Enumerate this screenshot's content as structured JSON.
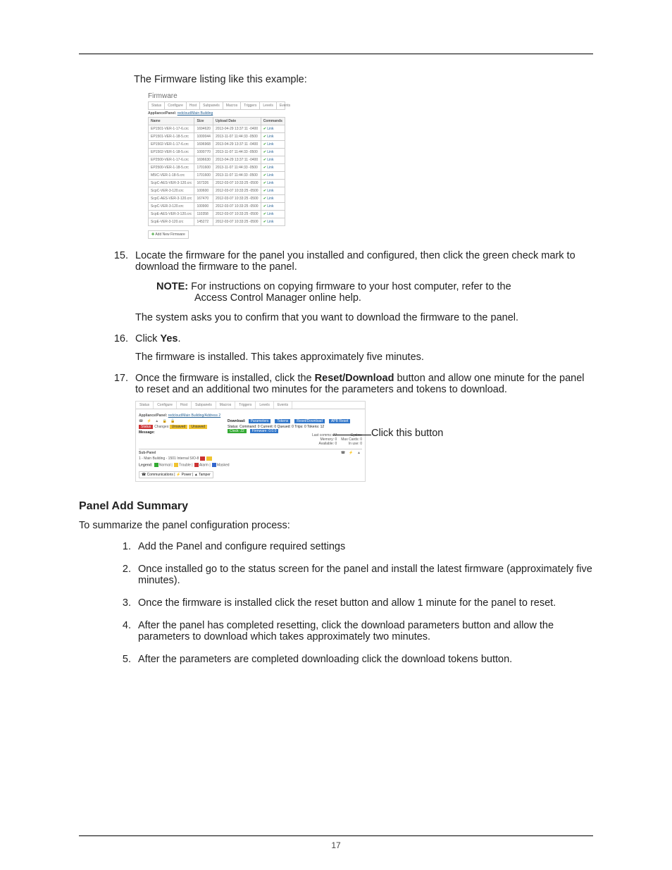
{
  "intro": "The Firmware listing like this example:",
  "firmware": {
    "title": "Firmware",
    "tabs": [
      "Status",
      "Configure",
      "Host",
      "Subpanels",
      "Macros",
      "Triggers",
      "Levels",
      "Events"
    ],
    "appLabel": "Appliance/Panel:",
    "appValue": "redcloud/Main Building",
    "headers": [
      "Name",
      "Size",
      "Upload Date",
      "Commands"
    ],
    "rows": [
      [
        "EP1501-VER-1-17-6.crc",
        "1694620",
        "2013-04-29 13:37:11 -0400"
      ],
      [
        "EP1501-VER-1-18-5.crc",
        "1000044",
        "2013-11-07 11:44:33 -0500"
      ],
      [
        "EP1502-VER-1-17-6.crc",
        "1696968",
        "2013-04-29 13:37:11 -0400"
      ],
      [
        "EP1502-VER-1-18-5.crc",
        "1000770",
        "2013-11-07 11:44:33 -0500"
      ],
      [
        "EP2500-VER-1-17-6.crc",
        "1696630",
        "2013-04-29 13:37:11 -0400"
      ],
      [
        "EP2500-VER-1-18-5.crc",
        "1701600",
        "2013-11-07 11:44:33 -0500"
      ],
      [
        "M5IC-VER-1-18-5.crc",
        "1701600",
        "2013-11-07 11:44:33 -0500"
      ],
      [
        "ScpC-AES-VER-3-120.crc",
        "167326",
        "2012-03-07 10:33:25 -0500"
      ],
      [
        "ScpC-VER-3-120.crc",
        "100600",
        "2012-03-07 10:33:25 -0500"
      ],
      [
        "ScpC-AES-VER-3-120.crc",
        "167470",
        "2012-03-07 10:33:25 -0500"
      ],
      [
        "ScpC-VER-3-120.crc",
        "100900",
        "2012-03-07 10:33:25 -0500"
      ],
      [
        "ScpE-AES-VER-3-120.crc",
        "110358",
        "2012-03-07 10:33:25 -0500"
      ],
      [
        "ScpE-VER-3-120.crc",
        "145272",
        "2012-03-07 10:33:25 -0500"
      ]
    ],
    "cmdLink": "Link",
    "addNew": "Add New Firmware"
  },
  "step15": {
    "text": "Locate the firmware for the panel you installed and configured, then click the green check mark to download the firmware to the panel.",
    "noteLabel": "NOTE:",
    "noteLine1": "For instructions on copying firmware to your host computer, refer to the",
    "noteLine2": "Access Control Manager online help.",
    "after": "The system asks you to confirm that you want to download the firmware to the panel."
  },
  "step16": {
    "pre": "Click ",
    "bold": "Yes",
    "post": ".",
    "after": "The firmware is installed. This takes approximately five minutes."
  },
  "step17": {
    "pre": "Once the firmware is installed, click the ",
    "bold": "Reset/Download",
    "post": " button and allow one minute for the panel to reset and an additional two minutes for the parameters and tokens to download."
  },
  "status": {
    "tabs": [
      "Status",
      "Configure",
      "Host",
      "Subpanels",
      "Macros",
      "Triggers",
      "Levels",
      "Events"
    ],
    "appLabel": "Appliance/Panel:",
    "appValue": "redcloud/Main Building/Address 2",
    "msgLabel": "Message:",
    "statusWord": "Status",
    "changesLabel": "Changes:",
    "unsaved1": "Unsaved",
    "unsaved2": "Unsaved",
    "dlLabel": "Download:",
    "btnParams": "Parameters",
    "btnTokens": "Tokens",
    "btnReset": "Reset/Download",
    "btnApb": "APB Reset",
    "line_status": "Status: Command: 0   Current: 0  Queued: 0   Trips: 0  Tokens: 12",
    "clock": "Clock: 22",
    "fw": "Firmware: 0.0.0",
    "leftCol": [
      "Last comms: 77",
      "Memory: 0",
      "Available: 0"
    ],
    "rightCol": [
      "Cycles:",
      "Max Cards: 0",
      "In use: 0"
    ],
    "subPanel": "Sub-Panel",
    "subRow": "1 - Main Building - 1501 Internal SIO-8",
    "legendLabel": "Legend:",
    "legendItems": [
      "Normal",
      "Trouble",
      "Alarm",
      "Masked"
    ],
    "bottomBtns": [
      "Communications",
      "Power",
      "Tamper"
    ],
    "callout": "Click this button"
  },
  "summary": {
    "heading": "Panel Add Summary",
    "intro": "To summarize the panel configuration process:",
    "items": [
      "Add the Panel and configure required settings",
      "Once installed go to the status screen for the panel and install the latest firmware (approximately five minutes).",
      "Once the firmware is installed click the reset button and allow 1 minute for the panel to reset.",
      "After the panel has completed resetting, click the download parameters button and allow the parameters to download which takes approximately two minutes.",
      "After the parameters are completed downloading click the download tokens button."
    ]
  },
  "pageNumber": "17"
}
